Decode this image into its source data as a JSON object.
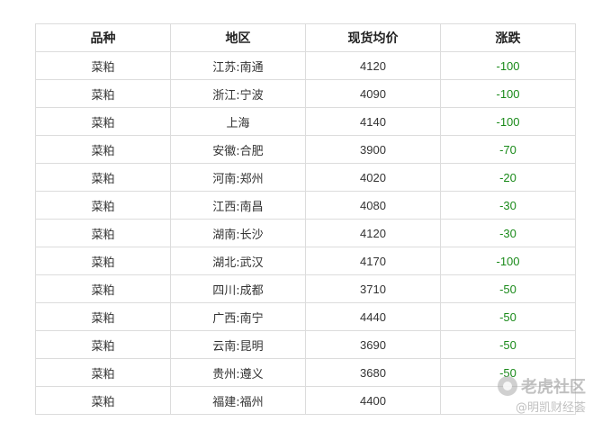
{
  "table": {
    "headers": [
      "品种",
      "地区",
      "现货均价",
      "涨跌"
    ],
    "rows": [
      {
        "variety": "菜粕",
        "region": "江苏:南通",
        "price": "4120",
        "change": "-100"
      },
      {
        "variety": "菜粕",
        "region": "浙江:宁波",
        "price": "4090",
        "change": "-100"
      },
      {
        "variety": "菜粕",
        "region": "上海",
        "price": "4140",
        "change": "-100"
      },
      {
        "variety": "菜粕",
        "region": "安徽:合肥",
        "price": "3900",
        "change": "-70"
      },
      {
        "variety": "菜粕",
        "region": "河南:郑州",
        "price": "4020",
        "change": "-20"
      },
      {
        "variety": "菜粕",
        "region": "江西:南昌",
        "price": "4080",
        "change": "-30"
      },
      {
        "variety": "菜粕",
        "region": "湖南:长沙",
        "price": "4120",
        "change": "-30"
      },
      {
        "variety": "菜粕",
        "region": "湖北:武汉",
        "price": "4170",
        "change": "-100"
      },
      {
        "variety": "菜粕",
        "region": "四川:成都",
        "price": "3710",
        "change": "-50"
      },
      {
        "variety": "菜粕",
        "region": "广西:南宁",
        "price": "4440",
        "change": "-50"
      },
      {
        "variety": "菜粕",
        "region": "云南:昆明",
        "price": "3690",
        "change": "-50"
      },
      {
        "variety": "菜粕",
        "region": "贵州:遵义",
        "price": "3680",
        "change": "-50"
      },
      {
        "variety": "菜粕",
        "region": "福建:福州",
        "price": "4400",
        "change": ""
      }
    ]
  },
  "colors": {
    "change_negative": "#1a8a1a",
    "border": "#dcdcdc"
  },
  "watermark": {
    "line1": "老虎社区",
    "line2": "@明凯财经荟"
  }
}
